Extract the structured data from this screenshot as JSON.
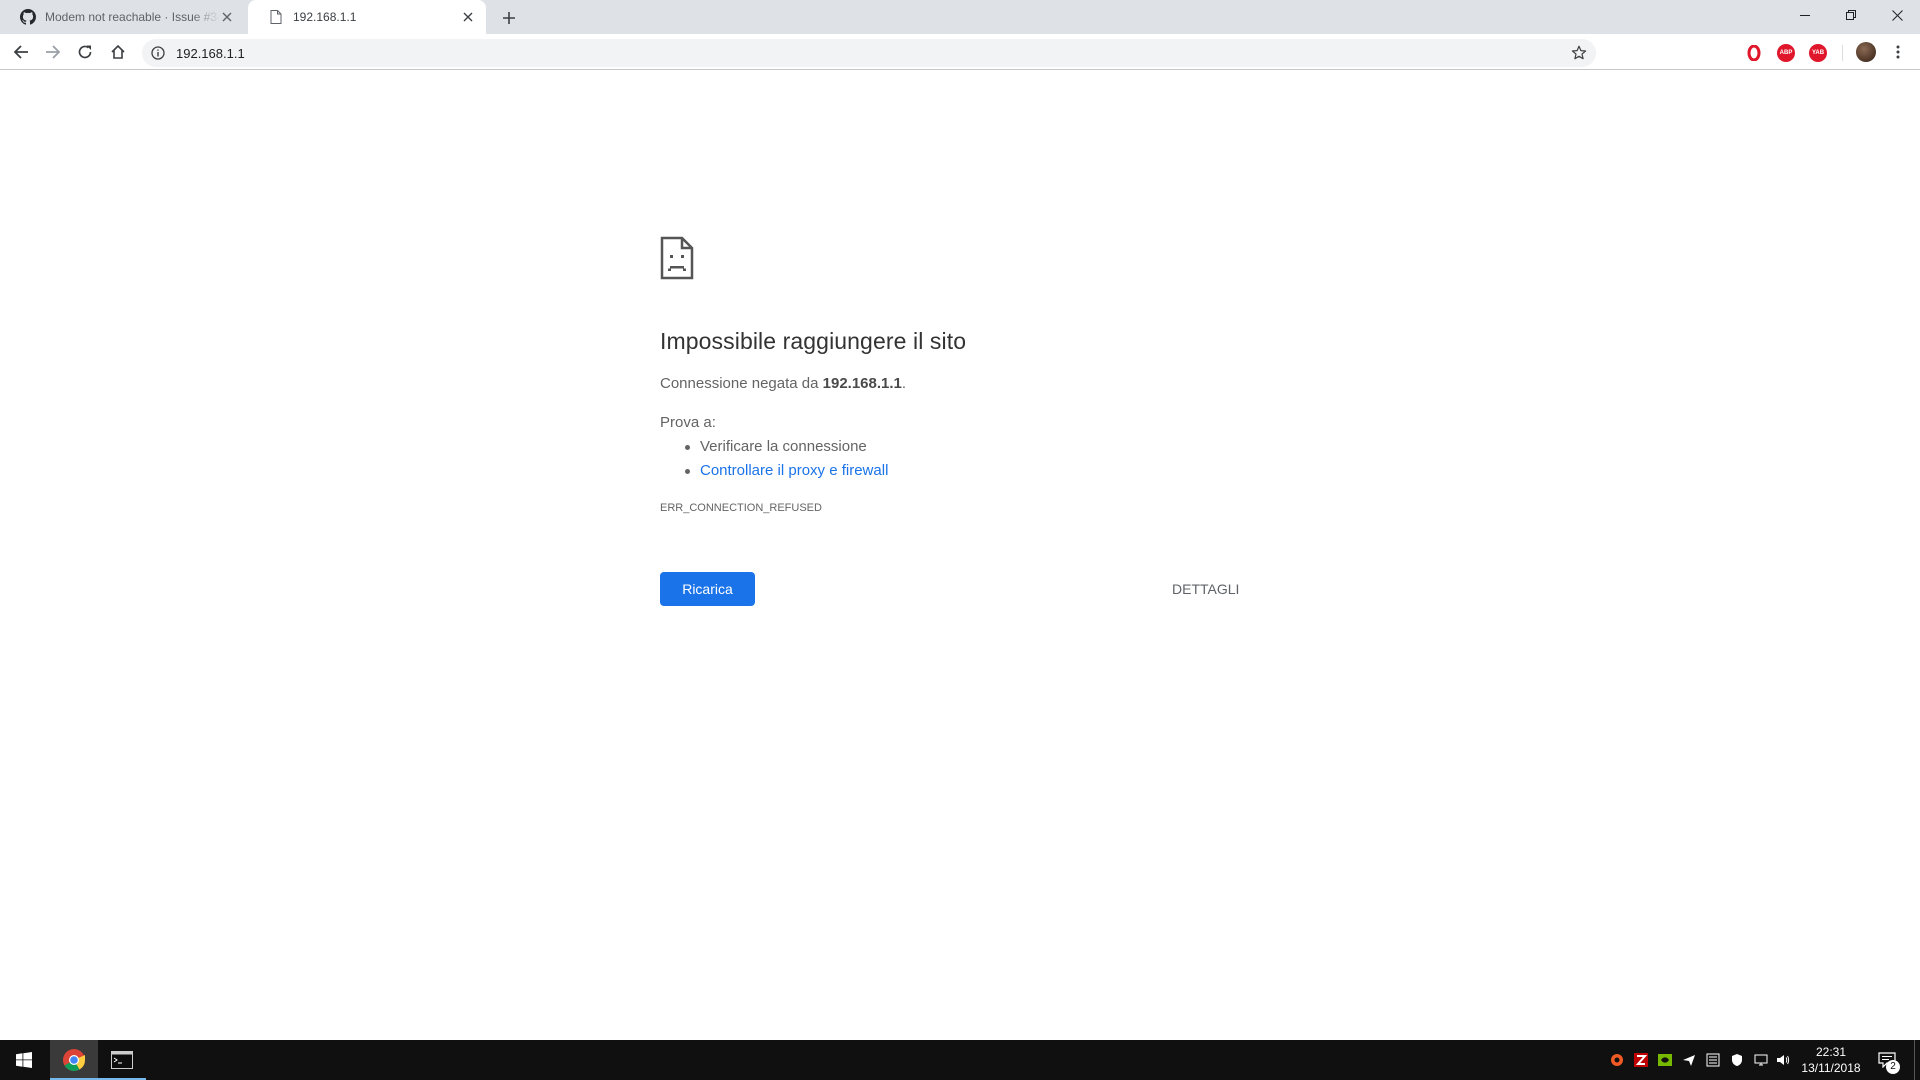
{
  "browser": {
    "tabs": [
      {
        "title": "Modem not reachable · Issue #34",
        "icon": "github-icon",
        "active": false
      },
      {
        "title": "192.168.1.1",
        "icon": "page-icon",
        "active": true
      }
    ],
    "address": "192.168.1.1",
    "extensions": [
      "opera-icon",
      "adblock-icon",
      "yab-icon"
    ],
    "ext_labels": {
      "abp": "ABP",
      "yab": "YAB"
    }
  },
  "error_page": {
    "title": "Impossibile raggiungere il sito",
    "message_prefix": "Connessione negata da ",
    "message_host": "192.168.1.1",
    "message_suffix": ".",
    "try_label": "Prova a:",
    "suggestions": [
      {
        "text": "Verificare la connessione",
        "link": false
      },
      {
        "text": "Controllare il proxy e firewall",
        "link": true
      }
    ],
    "error_code": "ERR_CONNECTION_REFUSED",
    "reload_label": "Ricarica",
    "details_label": "DETTAGLI"
  },
  "taskbar": {
    "apps": [
      "chrome-icon",
      "terminal-icon"
    ],
    "time": "22:31",
    "date": "13/11/2018",
    "notification_count": "2"
  },
  "colors": {
    "accent": "#1a73e8",
    "tabstrip": "#dee1e6",
    "taskbar": "#101010"
  }
}
